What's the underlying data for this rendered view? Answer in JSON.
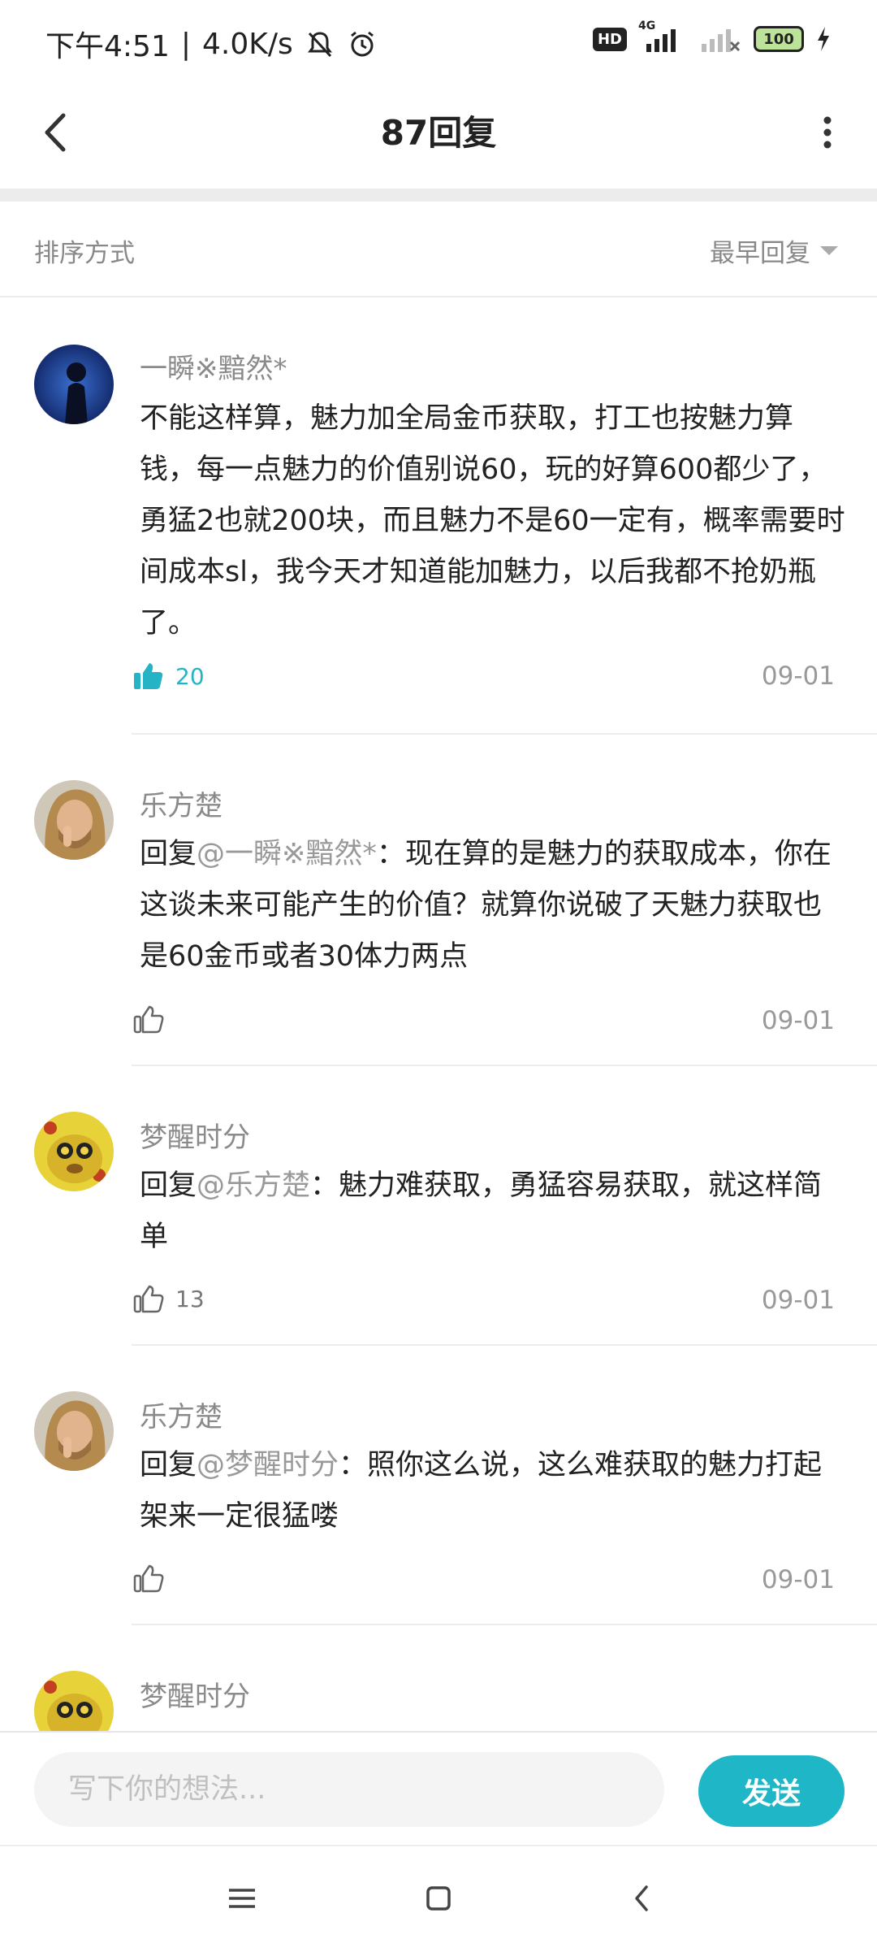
{
  "status_bar": {
    "time": "下午4:51",
    "net_speed": "4.0K/s",
    "hd_badge": "HD",
    "network": "4G",
    "battery": "100"
  },
  "header": {
    "title": "87回复"
  },
  "sort": {
    "label": "排序方式",
    "selected": "最早回复"
  },
  "comments": [
    {
      "username": "一瞬※黯然*",
      "reply_prefix": "",
      "mention": "",
      "text": "不能这样算，魅力加全局金币获取，打工也按魅力算钱，每一点魅力的价值别说60，玩的好算600都少了，勇猛2也就200块，而且魅力不是60一定有，概率需要时间成本sl，我今天才知道能加魅力，以后我都不抢奶瓶了。",
      "likes": "20",
      "liked": true,
      "date": "09-01"
    },
    {
      "username": "乐方楚",
      "reply_prefix": "回复",
      "mention": "@一瞬※黯然*",
      "text": "：现在算的是魅力的获取成本，你在这谈未来可能产生的价值？就算你说破了天魅力获取也是60金币或者30体力两点",
      "likes": "",
      "liked": false,
      "date": "09-01"
    },
    {
      "username": "梦醒时分",
      "reply_prefix": "回复",
      "mention": "@乐方楚",
      "text": "：魅力难获取，勇猛容易获取，就这样简单",
      "likes": "13",
      "liked": false,
      "date": "09-01"
    },
    {
      "username": "乐方楚",
      "reply_prefix": "回复",
      "mention": "@梦醒时分",
      "text": "：照你这么说，这么难获取的魅力打起架来一定很猛喽",
      "likes": "",
      "liked": false,
      "date": "09-01"
    },
    {
      "username": "梦醒时分"
    }
  ],
  "input": {
    "placeholder": "写下你的想法...",
    "send_label": "发送"
  },
  "colors": {
    "accent": "#1fb7c7",
    "text": "#222222",
    "muted": "#999999"
  }
}
